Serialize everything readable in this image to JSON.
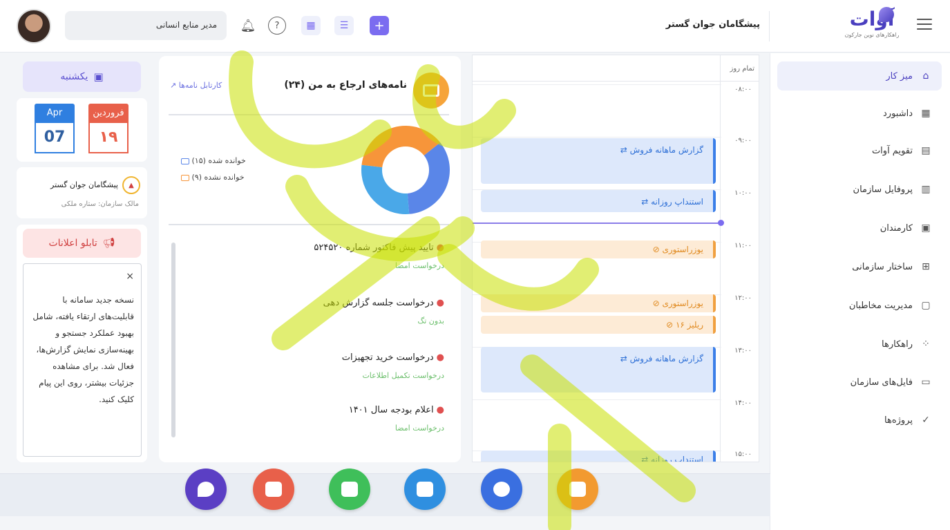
{
  "header": {
    "org_title": "پیشگامان جوان گستر",
    "role_label": "مدیر منابع انسانی",
    "logo_text": "آوات",
    "logo_sub": "راهکارهای نوین جارکون"
  },
  "sidebar": {
    "items": [
      {
        "label": "میز کار",
        "icon": "home-icon"
      },
      {
        "label": "داشبورد",
        "icon": "dashboard-icon"
      },
      {
        "label": "تقویم آوات",
        "icon": "calendar-icon"
      },
      {
        "label": "پروفایل سازمان",
        "icon": "building-icon"
      },
      {
        "label": "کارمندان",
        "icon": "employees-icon"
      },
      {
        "label": "ساختار سازمانی",
        "icon": "org-chart-icon"
      },
      {
        "label": "مدیریت مخاطبان",
        "icon": "contacts-icon"
      },
      {
        "label": "راهکارها",
        "icon": "apps-icon"
      },
      {
        "label": "فایل‌های سازمان",
        "icon": "folder-icon"
      },
      {
        "label": "پروژه‌ها",
        "icon": "clipboard-icon"
      }
    ]
  },
  "calendar": {
    "all_day": "تمام روز",
    "hours": [
      "۰۸:۰۰",
      "۰۹:۰۰",
      "۱۰:۰۰",
      "۱۱:۰۰",
      "۱۲:۰۰",
      "۱۳:۰۰",
      "۱۴:۰۰",
      "۱۵:۰۰"
    ],
    "events": [
      {
        "title": "⇄ گزارش ماهانه فروش",
        "kind": "blue"
      },
      {
        "title": "⇄ استنداپ روزانه",
        "kind": "blue"
      },
      {
        "title": "⊘ یوزراستوری",
        "kind": "orange"
      },
      {
        "title": "⊘ یوزراستوری",
        "kind": "orange"
      },
      {
        "title": "⊘ ریلیز ۱۶",
        "kind": "orange"
      },
      {
        "title": "⇄ گزارش ماهانه فروش",
        "kind": "blue"
      },
      {
        "title": "⇄ استنداپ روزانه",
        "kind": "blue"
      }
    ]
  },
  "letters": {
    "title": "نامه‌های ارجاع به من (۲۴)",
    "link": "↗ کارتابل نامه‌ها",
    "legend_read": "خوانده شده (۱۵)",
    "legend_unread": "خوانده نشده (۹)",
    "read_count": 15,
    "unread_count": 9,
    "requests": [
      {
        "title": "تایید پیش فاکتور شماره ۵۲۴۵۲۰",
        "tag": "درخواست امضا"
      },
      {
        "title": "درخواست جلسه گزارش دهی",
        "tag": "بدون تگ"
      },
      {
        "title": "درخواست خرید تجهیزات",
        "tag": "درخواست تکمیل اطلاعات"
      },
      {
        "title": "اعلام بودجه سال ۱۴۰۱",
        "tag": "درخواست امضا"
      }
    ]
  },
  "left": {
    "day_name": "یکشنبه",
    "jalali_month": "فروردین",
    "jalali_day": "۱۹",
    "greg_month": "Apr",
    "greg_day": "07",
    "org_name": "پیشگامان جوان گستر",
    "org_owner": "مالک سازمان: ستاره ملکی",
    "board_title": "تابلو اعلانات",
    "board_close": "×",
    "board_text": "نسخه جدید سامانه با قابلیت‌های ارتقاء یافته، شامل بهبود عملکرد جستجو و بهینه‌سازی نمایش گزارش‌ها، فعال شد. برای مشاهده جزئیات بیشتر، روی این پیام کلیک کنید."
  },
  "dock": {
    "apps": [
      {
        "name": "avat-app",
        "color": "#5b3fc4"
      },
      {
        "name": "contacts-app",
        "color": "#e8604a"
      },
      {
        "name": "chat-app",
        "color": "#3fbf5a"
      },
      {
        "name": "messages-app",
        "color": "#2f8fe0"
      },
      {
        "name": "team-app",
        "color": "#3a6fe0"
      },
      {
        "name": "letters-app",
        "color": "#f29a30"
      }
    ]
  },
  "colors": {
    "accent": "#7b6cf0",
    "donut_orange": "#f7953a",
    "donut_blue": "#5a86e8",
    "donut_lightblue": "#4aa8e8"
  }
}
